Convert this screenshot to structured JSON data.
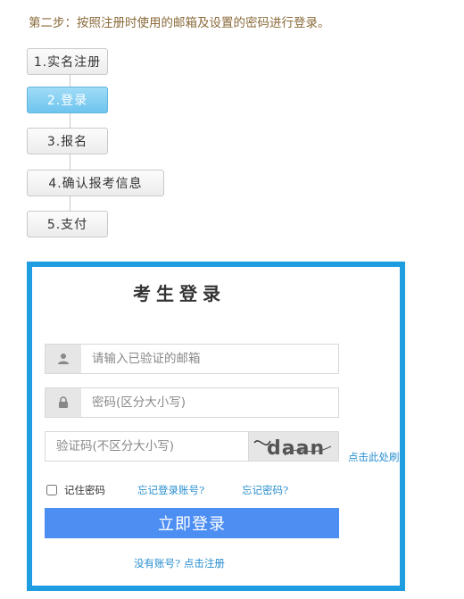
{
  "instruction": "第二步：按照注册时使用的邮箱及设置的密码进行登录。",
  "steps": [
    {
      "label": "1.实名注册",
      "active": false
    },
    {
      "label": "2.登录",
      "active": true
    },
    {
      "label": "3.报名",
      "active": false
    },
    {
      "label": "4.确认报考信息",
      "active": false
    },
    {
      "label": "5.支付",
      "active": false
    }
  ],
  "login": {
    "title": "考生登录",
    "email_placeholder": "请输入已验证的邮箱",
    "password_placeholder": "密码(区分大小写)",
    "captcha_placeholder": "验证码(不区分大小写)",
    "captcha_text": "daan",
    "captcha_refresh": "点击此处刷",
    "remember_label": "记住密码",
    "forgot_account": "忘记登录账号?",
    "forgot_password": "忘记密码?",
    "submit_label": "立即登录",
    "register_prompt": "没有账号? 点击注册"
  },
  "colors": {
    "accent": "#1e9de0",
    "button": "#4d8ef3",
    "link": "#2a8fd0",
    "active_step": "#7ccaf0"
  },
  "icons": {
    "email": "user-icon",
    "password": "lock-icon"
  }
}
